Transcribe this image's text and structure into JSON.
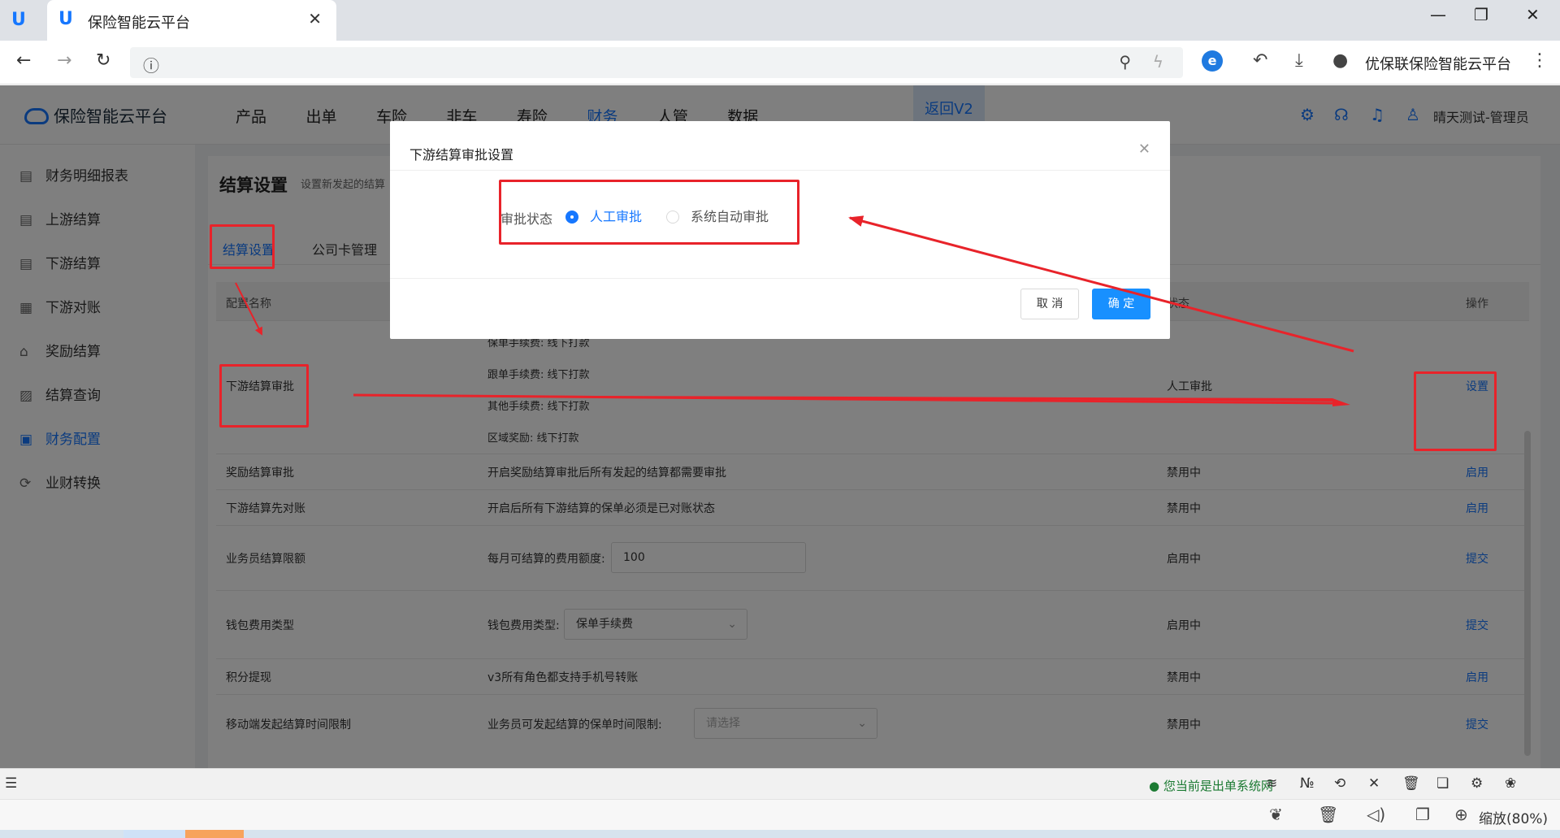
{
  "browser": {
    "tab_title": "保险智能云平台",
    "tab_close": "✕",
    "profile_name": "优保联保险智能云平台"
  },
  "app": {
    "brand": "保险智能云平台",
    "nav": [
      "产品",
      "出单",
      "车险",
      "非车",
      "寿险",
      "财务",
      "人管",
      "数据"
    ],
    "nav_active": "财务",
    "back_v2": "返回V2",
    "user": "晴天测试-管理员"
  },
  "sidebar": {
    "items": [
      {
        "label": "财务明细报表",
        "icon": "report-icon"
      },
      {
        "label": "上游结算",
        "icon": "list-icon"
      },
      {
        "label": "下游结算",
        "icon": "list-icon"
      },
      {
        "label": "下游对账",
        "icon": "document-icon"
      },
      {
        "label": "奖励结算",
        "icon": "lock-icon"
      },
      {
        "label": "结算查询",
        "icon": "search-doc-icon"
      },
      {
        "label": "财务配置",
        "icon": "settings-doc-icon"
      },
      {
        "label": "业财转换",
        "icon": "convert-icon"
      }
    ],
    "active": "财务配置"
  },
  "page": {
    "title": "结算设置",
    "subtitle": "设置新发起的结算",
    "tabs": [
      "结算设置",
      "公司卡管理"
    ],
    "active_tab": "结算设置"
  },
  "table": {
    "headers": {
      "name": "配置名称",
      "status": "状态",
      "action": "操作"
    },
    "rows": [
      {
        "name": "下游结算审批",
        "desc_lines": [
          "保单手续费: 线下打款",
          "跟单手续费: 线下打款",
          "其他手续费: 线下打款",
          "区域奖励: 线下打款"
        ],
        "status": "人工审批",
        "action": "设置"
      },
      {
        "name": "奖励结算审批",
        "desc": "开启奖励结算审批后所有发起的结算都需要审批",
        "status": "禁用中",
        "action": "启用"
      },
      {
        "name": "下游结算先对账",
        "desc": "开启后所有下游结算的保单必须是已对账状态",
        "status": "禁用中",
        "action": "启用"
      },
      {
        "name": "业务员结算限额",
        "desc": "每月可结算的费用额度:",
        "input_value": "100",
        "status": "启用中",
        "action": "提交"
      },
      {
        "name": "钱包费用类型",
        "desc": "钱包费用类型:",
        "select_value": "保单手续费",
        "status": "启用中",
        "action": "提交"
      },
      {
        "name": "积分提现",
        "desc": "v3所有角色都支持手机号转账",
        "status": "禁用中",
        "action": "启用"
      },
      {
        "name": "移动端发起结算时间限制",
        "desc": "业务员可发起结算的保单时间限制:",
        "select_placeholder": "请选择",
        "status": "禁用中",
        "action": "提交"
      }
    ]
  },
  "modal": {
    "title": "下游结算审批设置",
    "field_label": "审批状态",
    "options": [
      "人工审批",
      "系统自动审批"
    ],
    "selected": "人工审批",
    "cancel": "取 消",
    "ok": "确 定"
  },
  "statusbar": {
    "text": "您当前是出单系统网",
    "no_label": "№"
  },
  "bottombar": {
    "zoom": "缩放(80%)"
  },
  "colors": {
    "accent": "#1677ff",
    "annotation_red": "#e8232a",
    "status_green": "#1b7a32"
  }
}
